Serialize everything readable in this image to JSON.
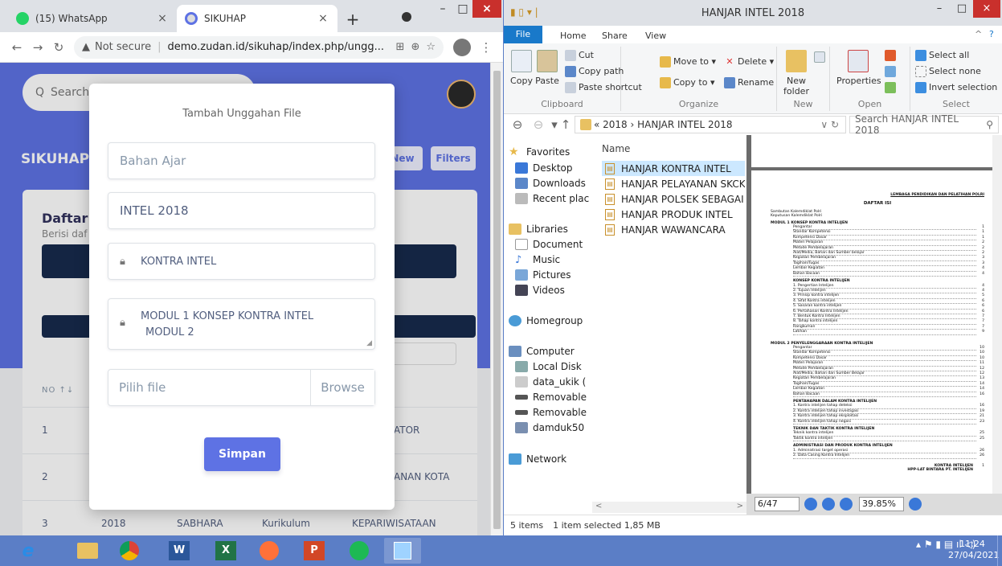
{
  "chrome": {
    "tabs": [
      {
        "title": "(15) WhatsApp",
        "badge": "15"
      },
      {
        "title": "SIKUHAP"
      }
    ],
    "new_tab": "+",
    "address": {
      "warning": "Not secure",
      "url": "demo.zudan.id/sikuhap/index.php/ungg..."
    }
  },
  "page": {
    "search_placeholder": "Search",
    "brand": "SIKUHAP",
    "new_button": "New",
    "filters_button": "Filters",
    "card_title": "Daftar U",
    "card_subtitle": "Berisi daf",
    "table_header": "NO ↑↓",
    "rows": [
      {
        "no": "1",
        "tail": "ATOR"
      },
      {
        "no": "2",
        "tail": "ANAN KOTA"
      },
      {
        "no": "3",
        "year": "2018",
        "dept": "SABHARA",
        "cat": "Kurikulum",
        "name": "KEPARIWISATAAN"
      }
    ]
  },
  "modal": {
    "title": "Tambah Unggahan File",
    "field1_placeholder": "Bahan Ajar",
    "field2_value": "INTEL 2018",
    "field3_value": "KONTRA INTEL",
    "field4_line1": "MODUL 1 KONSEP KONTRA INTEL",
    "field4_line2": "MODUL 2",
    "file_placeholder": "Pilih file",
    "browse_label": "Browse",
    "save_label": "Simpan"
  },
  "explorer": {
    "title": "HANJAR INTEL 2018",
    "ribbon_tabs": [
      "File",
      "Home",
      "Share",
      "View"
    ],
    "ribbon": {
      "clipboard": {
        "copy": "Copy",
        "paste": "Paste",
        "cut": "Cut",
        "copy_path": "Copy path",
        "paste_shortcut": "Paste shortcut",
        "label": "Clipboard"
      },
      "organize": {
        "move_to": "Move to ▾",
        "delete": "Delete ▾",
        "copy_to": "Copy to ▾",
        "rename": "Rename",
        "label": "Organize"
      },
      "new": {
        "new_folder": "New folder",
        "label": "New"
      },
      "open": {
        "properties": "Properties",
        "label": "Open"
      },
      "select": {
        "select_all": "Select all",
        "select_none": "Select none",
        "invert": "Invert selection",
        "label": "Select"
      }
    },
    "breadcrumb": "« 2018 › HANJAR INTEL 2018",
    "search_placeholder": "Search HANJAR INTEL 2018",
    "nav": {
      "favorites": "Favorites",
      "desktop": "Desktop",
      "downloads": "Downloads",
      "recent": "Recent plac",
      "libraries": "Libraries",
      "documents": "Document",
      "music": "Music",
      "pictures": "Pictures",
      "videos": "Videos",
      "homegroup": "Homegroup",
      "computer": "Computer",
      "local_disk": "Local Disk",
      "data_ukik": "data_ukik (",
      "removable1": "Removable",
      "removable2": "Removable",
      "damduk": "damduk50",
      "network": "Network"
    },
    "column_name": "Name",
    "files": [
      "HANJAR KONTRA INTEL",
      "HANJAR PELAYANAN SKCK DA",
      "HANJAR POLSEK SEBAGAI BASI",
      "HANJAR PRODUK INTEL",
      "HANJAR WAWANCARA"
    ],
    "status": {
      "items": "5 items",
      "selected": "1 item selected 1,85 MB"
    },
    "pdf": {
      "page": "6/47",
      "zoom": "39.85%"
    }
  },
  "doc": {
    "institution": "LEMBAGA PENDIDIKAN DAN PELATIHAN POLRI",
    "heading": "DAFTAR ISI",
    "pre": [
      "Sambutan Kalemdiklat Polri",
      "Keputusan Kalemdiklat Polri"
    ],
    "modul1_title": "MODUL 1   KONSEP KONTRA INTELIJEN",
    "modul1": [
      [
        "Pengantar",
        "1"
      ],
      [
        "Standar Kompetensi",
        "1"
      ],
      [
        "Kompetensi Dasar",
        "1"
      ],
      [
        "Materi Pelajaran",
        "2"
      ],
      [
        "Metode Pembelajaran",
        "2"
      ],
      [
        "Alat/Media, Bahan dan Sumber belajar",
        "2"
      ],
      [
        "Kegiatan Pembelajaran",
        "3"
      ],
      [
        "Tagihan/Tugas",
        "3"
      ],
      [
        "Lembar Kegiatan",
        "4"
      ],
      [
        "Bahan Bacaan",
        "4"
      ]
    ],
    "modul1_sub": "KONSEP KONTRA INTELIJEN",
    "modul1_items": [
      [
        "1. Pengertian Intelijen",
        "4"
      ],
      [
        "2. Tujuan Intelijen",
        "4"
      ],
      [
        "3. Prinsip kontra intelijen",
        "5"
      ],
      [
        "4. Sifat Kontra intelijen",
        "6"
      ],
      [
        "5. Sasaran kontra intelijen",
        "6"
      ],
      [
        "6. Pertahanan Kontra Intelijen",
        "6"
      ],
      [
        "7. Bentuk Kontra Intelijen",
        "7"
      ],
      [
        "8. Tahap kontra intelijen",
        "7"
      ],
      [
        "Rangkuman",
        "7"
      ],
      [
        "Latihan",
        "9"
      ]
    ],
    "modul2_title": "MODUL 2   PENYELENGGARAAN KONTRA INTELIJEN",
    "modul2": [
      [
        "Pengantar",
        "10"
      ],
      [
        "Standar Kompetensi",
        "10"
      ],
      [
        "Kompetensi Dasar",
        "10"
      ],
      [
        "Materi Pelajaran",
        "11"
      ],
      [
        "Metode Pembelajaran",
        "12"
      ],
      [
        "Alat/Media, Bahan dan Sumber Belajar",
        "12"
      ],
      [
        "Kegiatan Pembelajaran",
        "13"
      ],
      [
        "Tagihan/Tugas",
        "14"
      ],
      [
        "Lembar Kegiatan",
        "14"
      ],
      [
        "Bahan Bacaan",
        "16"
      ]
    ],
    "modul2_sub1": "PENTAHAPAN DALAM KONTRA INTELIJEN",
    "modul2_items1": [
      [
        "1. Kontra intelijen tahap deteksi",
        "16"
      ],
      [
        "2. Kontra intelijen tahap investigasi",
        "19"
      ],
      [
        "3. Kontra intelijen tahap eksploitasi",
        "21"
      ],
      [
        "4. Kontra intelijen tahap negasi",
        "23"
      ]
    ],
    "modul2_sub2": "TEKNIK DAN TAKTIK KONTRA INTELIJEN",
    "modul2_items2": [
      [
        "Teknik kontra intelijen",
        "25"
      ],
      [
        "Taktik kontra intelijen",
        "25"
      ]
    ],
    "modul2_sub3": "ADMINISTRASI DAN PRODUK KONTRA INTELIJEN",
    "modul2_items3": [
      [
        "1. Administrasi target operasi",
        "26"
      ],
      [
        "2. Data Casing Kontra Intelijen",
        "26"
      ]
    ],
    "footer": "KONTRA INTELIJEN\nHPP-LAT BINTARA PT. INTELIJEN",
    "footer_page": "1"
  },
  "taskbar": {
    "apps": [
      "ie",
      "explorer",
      "chrome",
      "word",
      "excel",
      "firefox",
      "powerpoint",
      "spotify",
      "control-panel"
    ],
    "time": "11:24",
    "date": "27/04/2021"
  },
  "colors": {
    "primary": "#5e72e4",
    "dark": "#172b4d",
    "taskbar": "#5b7ec6",
    "selection": "#cce8ff"
  }
}
